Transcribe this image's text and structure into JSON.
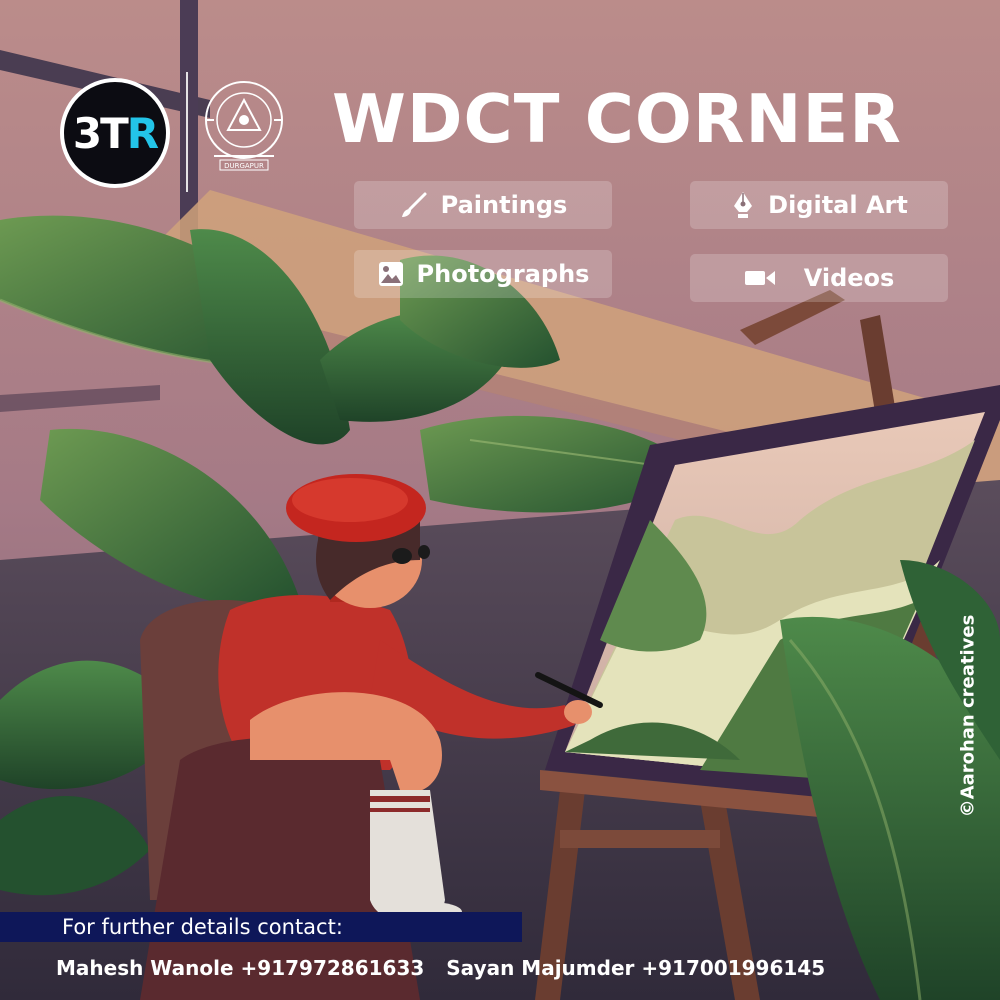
{
  "logo": {
    "left_text": "3T",
    "right_text": "R"
  },
  "seal": {
    "name": "institute-seal",
    "bottom_text": "DURGAPUR"
  },
  "title": "WDCT CORNER",
  "categories": [
    {
      "label": "Paintings",
      "icon": "paintbrush-icon"
    },
    {
      "label": "Digital Art",
      "icon": "pen-nib-icon"
    },
    {
      "label": "Photographs",
      "icon": "image-icon"
    },
    {
      "label": "Videos",
      "icon": "video-camera-icon"
    }
  ],
  "credit": "©Aarohan creatives",
  "contact": {
    "heading": "For further details contact:",
    "people": [
      {
        "name": "Mahesh Wanole",
        "phone": "+917972861633"
      },
      {
        "name": "Sayan Majumder",
        "phone": "+917001996145"
      }
    ]
  },
  "colors": {
    "sky_top": "#bb8c8a",
    "sky_mid": "#a57a86",
    "floor": "#413b4a",
    "band": "#d0a27b",
    "leaf": "#3f7a42",
    "beret": "#c4261f",
    "contact_band": "#0e1759",
    "logo_accent": "#23c4e8"
  }
}
